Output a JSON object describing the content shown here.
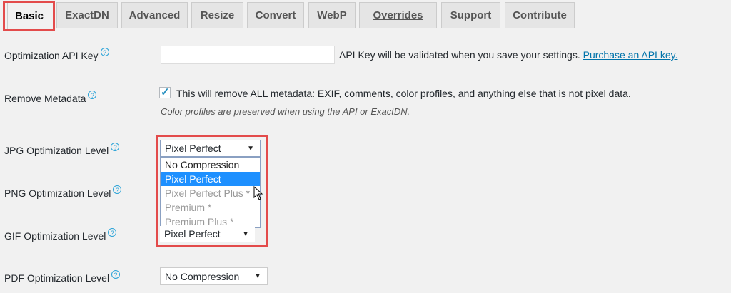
{
  "tabs": [
    {
      "label": "Basic"
    },
    {
      "label": "ExactDN"
    },
    {
      "label": "Advanced"
    },
    {
      "label": "Resize"
    },
    {
      "label": "Convert"
    },
    {
      "label": "WebP"
    },
    {
      "label": "Overrides"
    },
    {
      "label": "Support"
    },
    {
      "label": "Contribute"
    }
  ],
  "api_key": {
    "label": "Optimization API Key",
    "value": "",
    "hint": "API Key will be validated when you save your settings.",
    "link": "Purchase an API key."
  },
  "metadata": {
    "label": "Remove Metadata",
    "checked": true,
    "text": "This will remove ALL metadata: EXIF, comments, color profiles, and anything else that is not pixel data.",
    "note": "Color profiles are preserved when using the API or ExactDN."
  },
  "jpg": {
    "label": "JPG Optimization Level",
    "selected": "Pixel Perfect"
  },
  "dropdown_options": [
    {
      "label": "No Compression"
    },
    {
      "label": "Pixel Perfect"
    },
    {
      "label": "Pixel Perfect Plus *"
    },
    {
      "label": "Premium *"
    },
    {
      "label": "Premium Plus *"
    }
  ],
  "png": {
    "label": "PNG Optimization Level"
  },
  "gif": {
    "label": "GIF Optimization Level",
    "selected": "Pixel Perfect"
  },
  "pdf": {
    "label": "PDF Optimization Level",
    "selected": "No Compression"
  },
  "icons": {
    "help": "help-circle-icon",
    "arrow": "dropdown-arrow-icon",
    "cursor": "mouse-pointer-icon",
    "check": "checkmark-icon"
  },
  "colors": {
    "highlight": "#e34b4b",
    "link": "#0073aa",
    "selected_option": "#1e90ff",
    "help": "#2aa3d8"
  }
}
